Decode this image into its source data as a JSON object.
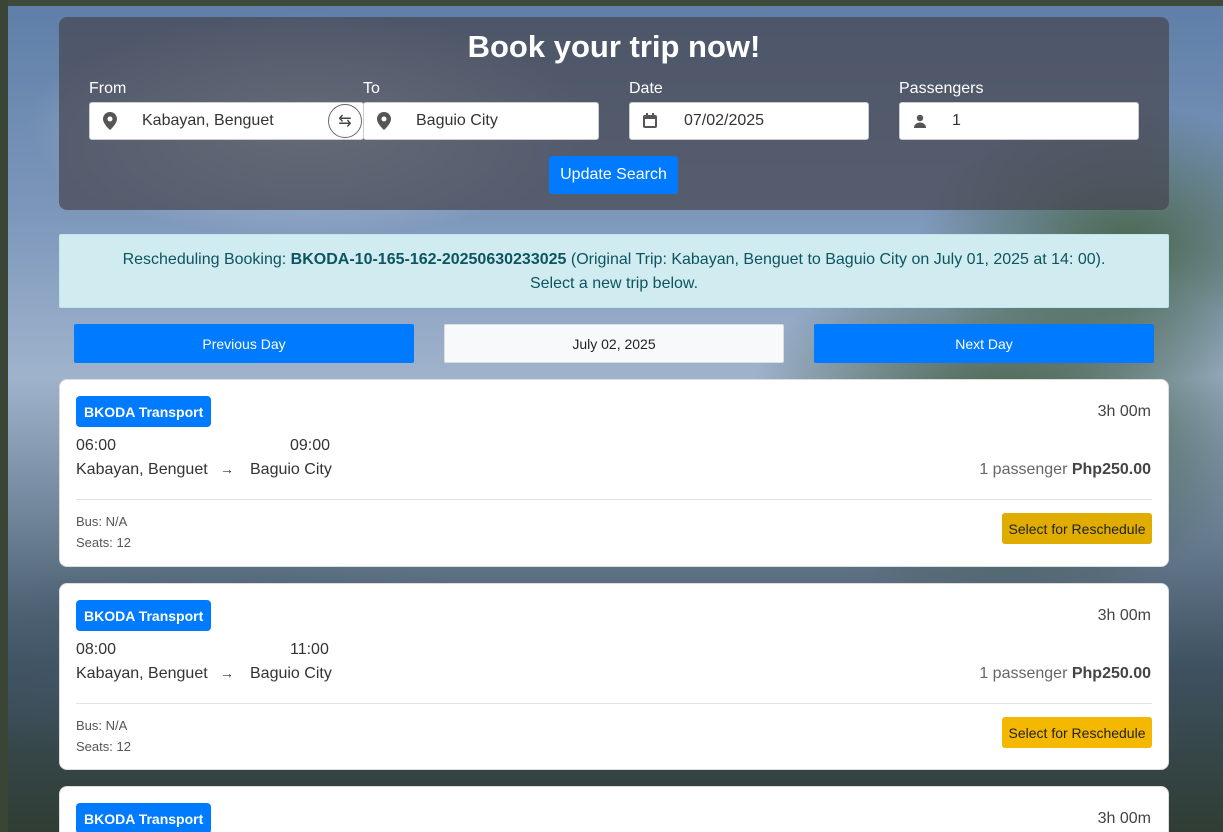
{
  "search": {
    "title": "Book your trip now!",
    "from_label": "From",
    "from_value": "Kabayan, Benguet",
    "to_label": "To",
    "to_value": "Baguio City",
    "date_label": "Date",
    "date_value": "07/02/2025",
    "passengers_label": "Passengers",
    "passengers_value": "1",
    "update_button": "Update Search",
    "swap_icon": "swap-arrows-icon"
  },
  "alert": {
    "prefix": "Rescheduling Booking: ",
    "booking_code": "BKODA-10-165-162-20250630233025",
    "original_trip": " (Original Trip: Kabayan, Benguet to Baguio City on July 01, 2025 at 14: 00).",
    "line2": "Select a new trip below."
  },
  "day_nav": {
    "previous": "Previous Day",
    "current": "July 02, 2025",
    "next": "Next Day"
  },
  "trips": [
    {
      "operator": "BKODA Transport",
      "duration": "3h 00m",
      "departure": "06:00",
      "arrival": "09:00",
      "from": "Kabayan, Benguet",
      "arrow": "→",
      "to": "Baguio City",
      "passenger_text": "1 passenger ",
      "price": "Php250.00",
      "bus": "Bus: N/A",
      "seats": "Seats: 12",
      "action": "Select for Reschedule"
    },
    {
      "operator": "BKODA Transport",
      "duration": "3h 00m",
      "departure": "08:00",
      "arrival": "11:00",
      "from": "Kabayan, Benguet",
      "arrow": "→",
      "to": "Baguio City",
      "passenger_text": "1 passenger ",
      "price": "Php250.00",
      "bus": "Bus: N/A",
      "seats": "Seats: 12",
      "action": "Select for Reschedule"
    },
    {
      "operator": "BKODA Transport",
      "duration": "3h 00m"
    }
  ],
  "colors": {
    "primary": "#007bff",
    "warning": "#f5b800",
    "alert_bg": "#d1ecf1",
    "alert_text": "#0c5460"
  }
}
